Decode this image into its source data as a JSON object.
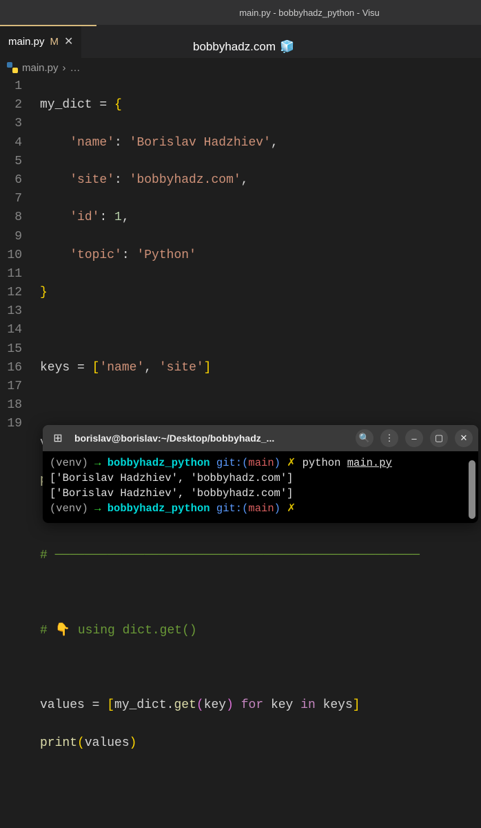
{
  "window": {
    "title": "main.py - bobbyhadz_python - Visu"
  },
  "tab": {
    "filename": "main.py",
    "modified_marker": "M",
    "close_glyph": "✕"
  },
  "watermark": {
    "text": "bobbyhadz.com",
    "emoji": "🧊"
  },
  "breadcrumb": {
    "filename": "main.py",
    "separator": "›",
    "rest": "…"
  },
  "code": {
    "lines": [
      {
        "n": 1
      },
      {
        "n": 2
      },
      {
        "n": 3
      },
      {
        "n": 4
      },
      {
        "n": 5
      },
      {
        "n": 6
      },
      {
        "n": 7
      },
      {
        "n": 8
      },
      {
        "n": 9
      },
      {
        "n": 10
      },
      {
        "n": 11
      },
      {
        "n": 12
      },
      {
        "n": 13
      },
      {
        "n": 14
      },
      {
        "n": 15
      },
      {
        "n": 16
      },
      {
        "n": 17
      },
      {
        "n": 18
      },
      {
        "n": 19
      }
    ],
    "t": {
      "my_dict": "my_dict",
      "eq": " = ",
      "lbrace": "{",
      "rbrace": "}",
      "key_name": "'name'",
      "val_name": "'Borislav Hadzhiev'",
      "key_site": "'site'",
      "val_site": "'bobbyhadz.com'",
      "key_id": "'id'",
      "val_id": "1",
      "key_topic": "'topic'",
      "val_topic": "'Python'",
      "colon": ": ",
      "comma": ",",
      "keys": "keys",
      "lbracket": "[",
      "rbracket": "]",
      "str_name": "'name'",
      "str_site": "'site'",
      "values": "values",
      "key": "key",
      "for": "for",
      "in": "in",
      "print": "print",
      "lparen": "(",
      "rparen": ")",
      "hash": "#",
      "hr": " ─────────────────────────────────────────────────",
      "pointer": "👇",
      "comment_get": " using dict.get()",
      "dot": ".",
      "get": "get",
      "sep": ", "
    }
  },
  "terminal": {
    "title": "borislav@borislav:~/Desktop/bobbyhadz_...",
    "venv": "(venv)",
    "arrow": "→",
    "dir": "bobbyhadz_python",
    "git": "git:",
    "lparen": "(",
    "branch": "main",
    "rparen": ")",
    "x": "✗",
    "cmd_python": "python",
    "cmd_file": "main.py",
    "out1": "['Borislav Hadzhiev', 'bobbyhadz.com']",
    "out2": "['Borislav Hadzhiev', 'bobbyhadz.com']",
    "icons": {
      "new_tab": "⊞",
      "search": "🔍",
      "menu": "⋮",
      "minimize": "–",
      "maximize": "▢",
      "close": "✕"
    }
  }
}
